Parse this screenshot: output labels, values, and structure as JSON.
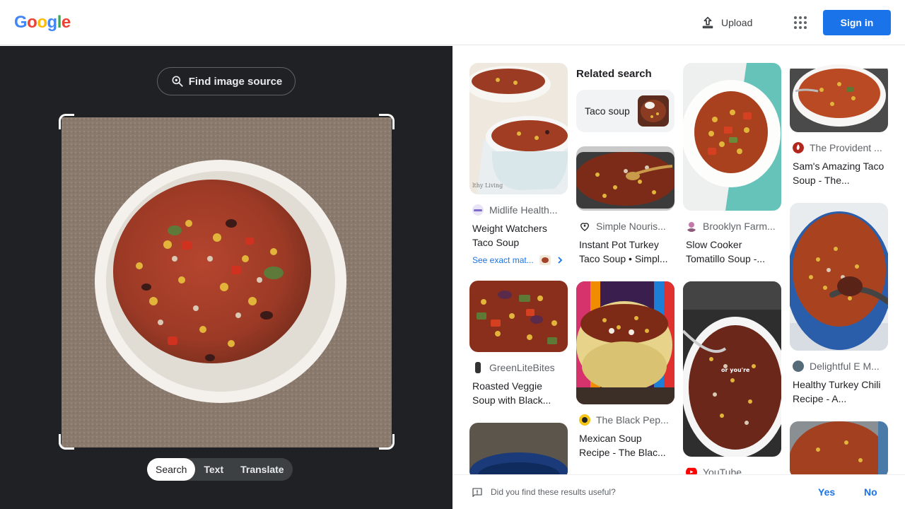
{
  "header": {
    "logo_letters": [
      "G",
      "o",
      "o",
      "g",
      "l",
      "e"
    ],
    "upload_label": "Upload",
    "signin_label": "Sign in"
  },
  "left": {
    "find_source_label": "Find image source",
    "tabs": [
      "Search",
      "Text",
      "Translate"
    ]
  },
  "right": {
    "related": {
      "title": "Related search",
      "pill_label": "Taco soup"
    },
    "see_exact": "See exact mat...",
    "cards": [
      {
        "source": "Midlife Health...",
        "title": "Weight Watchers Taco Soup"
      },
      {
        "source": "GreenLiteBites",
        "title": "Roasted Veggie Soup with Black..."
      },
      {
        "source": "Simple Nouris...",
        "title": "Instant Pot Turkey Taco Soup • Simpl..."
      },
      {
        "source": "The Black Pep...",
        "title": "Mexican Soup Recipe - The Blac..."
      },
      {
        "source": "Brooklyn Farm...",
        "title": "Slow Cooker Tomatillo Soup -..."
      },
      {
        "source": "YouTube",
        "title": ""
      },
      {
        "source": "The Provident ...",
        "title": "Sam's Amazing Taco Soup - The..."
      },
      {
        "source": "Delightful E M...",
        "title": "Healthy Turkey Chili Recipe - A..."
      }
    ],
    "video_caption": "or you're"
  },
  "feedback": {
    "question": "Did you find these results useful?",
    "yes": "Yes",
    "no": "No"
  },
  "colors": {
    "google_blue": "#4285F4",
    "google_red": "#EA4335",
    "google_yellow": "#FBBC05",
    "google_green": "#34A853",
    "link_blue": "#1a73e8",
    "dark_panel": "#202124"
  }
}
